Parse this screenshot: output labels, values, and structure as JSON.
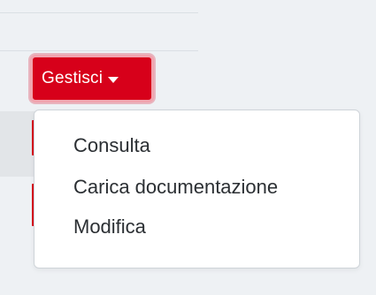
{
  "manage_button": {
    "label": "Gestisci",
    "color": "#d7001a"
  },
  "menu": {
    "items": [
      {
        "label": "Consulta"
      },
      {
        "label": "Carica documentazione"
      },
      {
        "label": "Modifica"
      }
    ]
  },
  "icons": {
    "toggle": "caret-down-icon"
  }
}
